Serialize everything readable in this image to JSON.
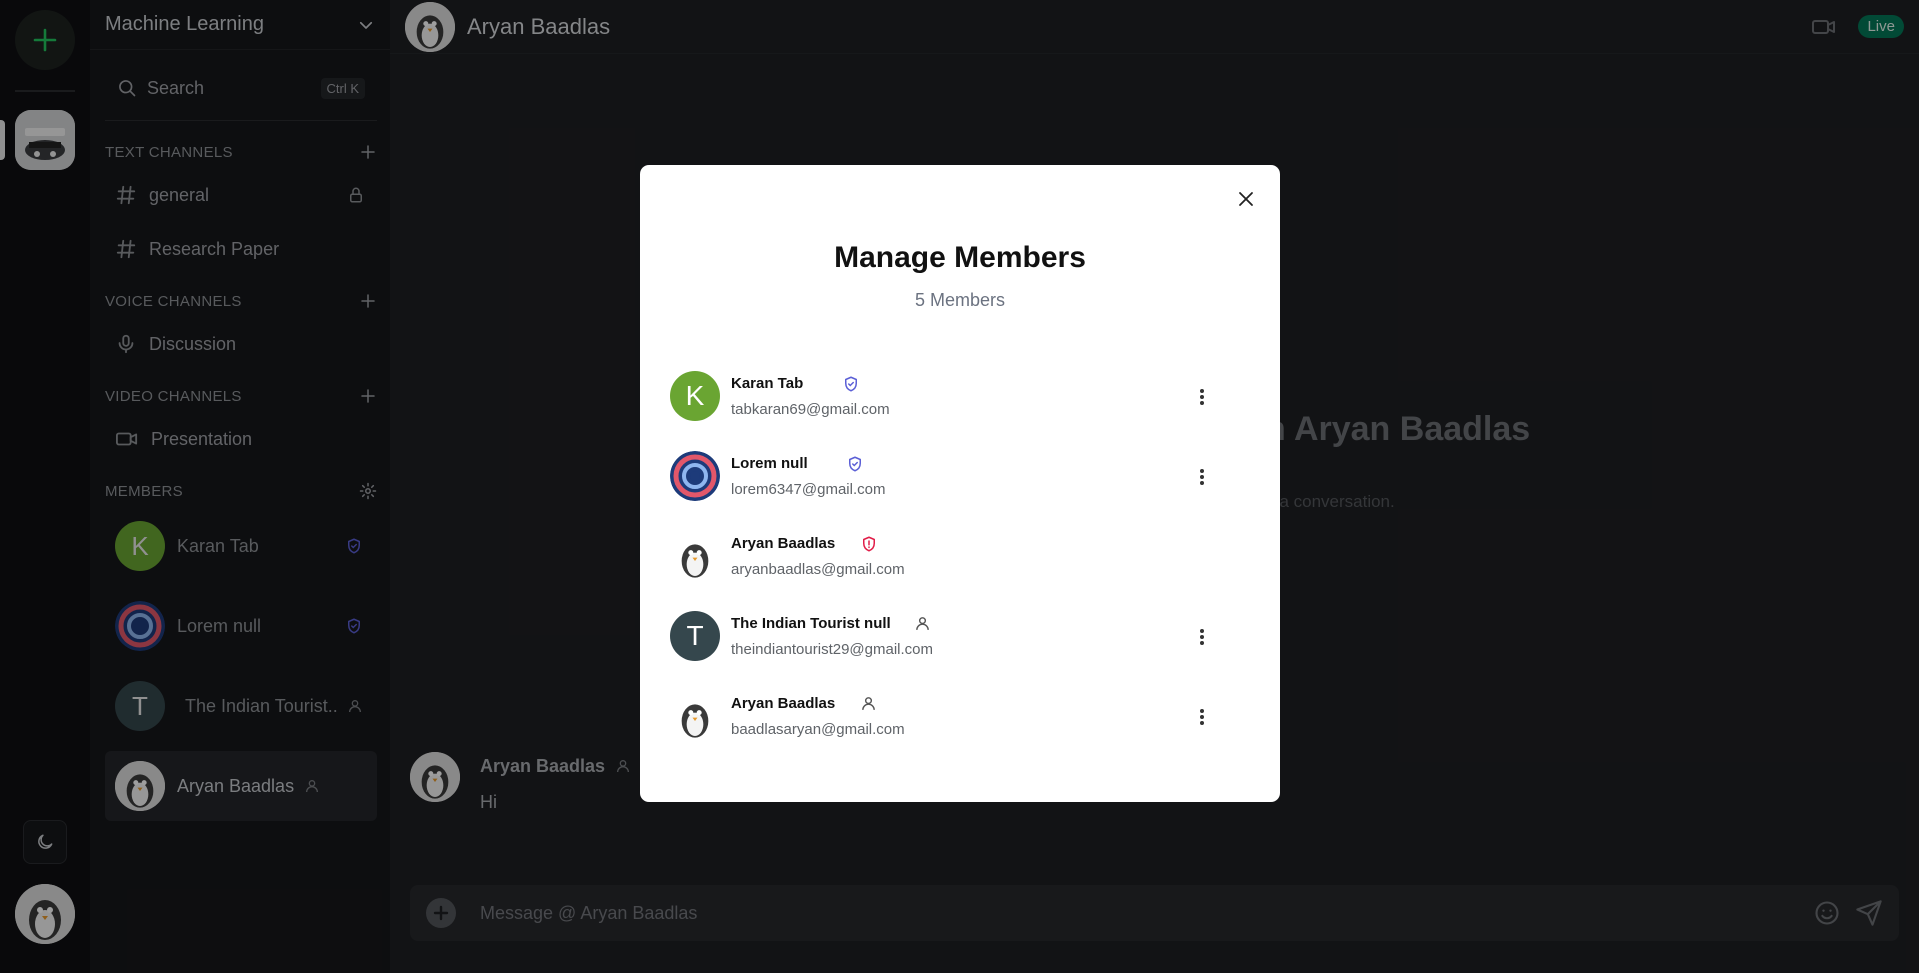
{
  "server": {
    "name": "Machine Learning"
  },
  "search": {
    "label": "Search",
    "shortcut": "Ctrl K"
  },
  "sections": {
    "text": "TEXT CHANNELS",
    "voice": "VOICE CHANNELS",
    "video": "VIDEO CHANNELS",
    "members": "MEMBERS"
  },
  "text_channels": [
    {
      "name": "general"
    },
    {
      "name": "Research Paper"
    }
  ],
  "voice_channels": [
    {
      "name": "Discussion"
    }
  ],
  "video_channels": [
    {
      "name": "Presentation"
    }
  ],
  "sidebar_members": [
    {
      "name": "Karan Tab",
      "initial": "K",
      "avatar_color": "#6aa532",
      "role_icon": "shield-check-icon"
    },
    {
      "name": "Lorem null",
      "role_icon": "shield-check-icon"
    },
    {
      "name": "The Indian Tourist..",
      "initial": "T",
      "avatar_color": "#35474d",
      "role_icon": "user-icon"
    },
    {
      "name": "Aryan Baadlas",
      "role_icon": "user-icon"
    }
  ],
  "chat": {
    "title": "Aryan Baadlas",
    "live_badge": "Live",
    "welcome": "h Aryan Baadlas",
    "welcome_sub": "t a conversation.",
    "message": {
      "author": "Aryan Baadlas",
      "text": "Hi"
    },
    "composer_placeholder": "Message @ Aryan Baadlas"
  },
  "modal": {
    "title": "Manage Members",
    "subtitle": "5 Members",
    "members": [
      {
        "name": "Karan Tab",
        "email": "tabkaran69@gmail.com",
        "initial": "K",
        "avatar_color": "#6aa532",
        "role_icon": "shield-check-icon",
        "role_color": "#5b5fd6",
        "has_menu": true
      },
      {
        "name": "Lorem null",
        "email": "lorem6347@gmail.com",
        "role_icon": "shield-check-icon",
        "role_color": "#5b5fd6",
        "has_menu": true
      },
      {
        "name": "Aryan Baadlas",
        "email": "aryanbaadlas@gmail.com",
        "role_icon": "shield-alert-icon",
        "role_color": "#e11d48",
        "has_menu": false
      },
      {
        "name": "The Indian Tourist null",
        "email": "theindiantourist29@gmail.com",
        "initial": "T",
        "avatar_color": "#35474d",
        "role_icon": "user-icon",
        "role_color": "#555555",
        "has_menu": true
      },
      {
        "name": "Aryan Baadlas",
        "email": "baadlasaryan@gmail.com",
        "role_icon": "user-icon",
        "role_color": "#555555",
        "has_menu": true
      }
    ]
  },
  "colors": {
    "accent_green": "#22c55e",
    "live_green": "#047857",
    "admin_blue": "#5b5fd6",
    "owner_red": "#e11d48"
  }
}
